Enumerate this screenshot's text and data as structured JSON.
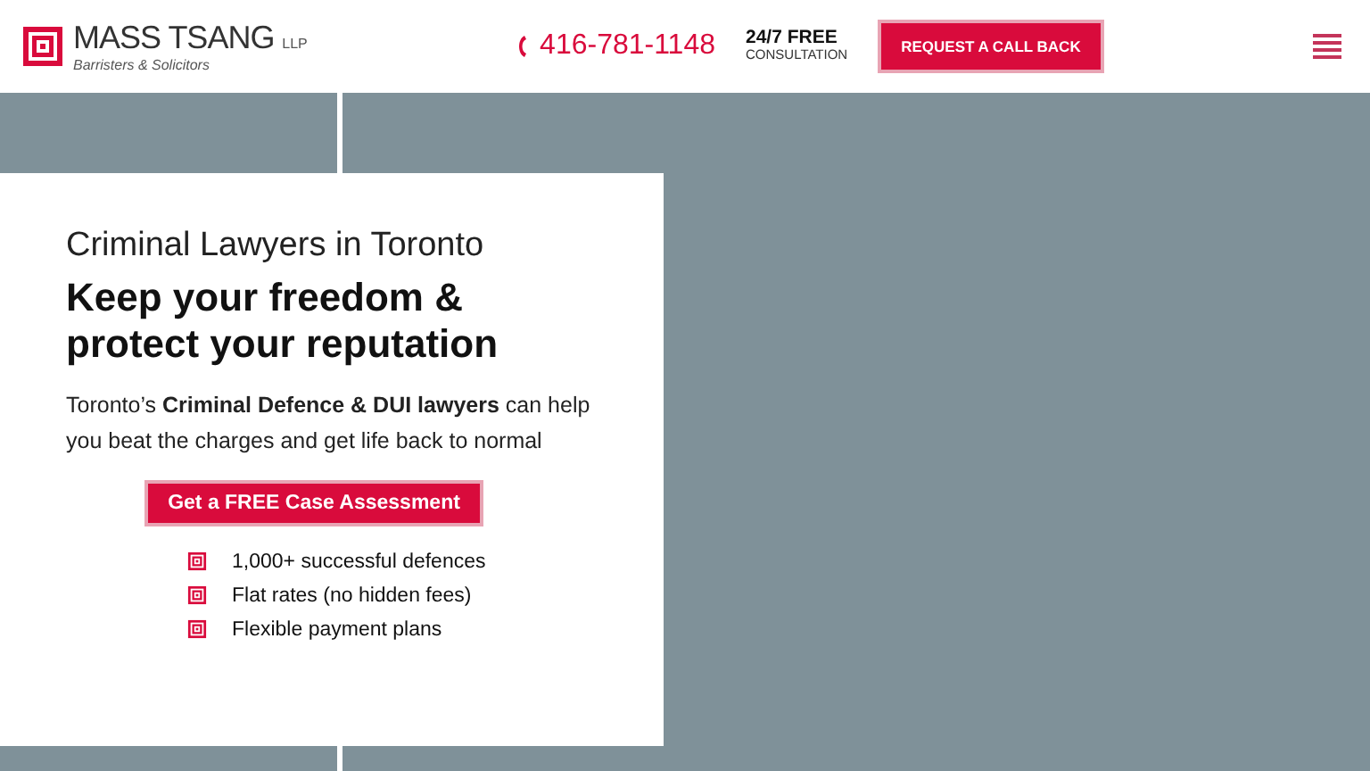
{
  "header": {
    "brand": "MASS TSANG",
    "brand_suffix": "LLP",
    "tagline": "Barristers & Solicitors",
    "phone": "416-781-1148",
    "hours": "24/7 FREE",
    "hours_sub": "CONSULTATION",
    "cta": "REQUEST A CALL BACK"
  },
  "hero": {
    "kicker": "Criminal Lawyers in Toronto",
    "headline": "Keep your freedom & protect your reputation",
    "intro": "Toronto’s **Criminal Defence & DUI lawyers** can help you beat the charges and get life back to normal",
    "button": "Get a FREE Case Assessment",
    "points": [
      "1,000+ successful defences",
      "Flat rates (no hidden fees)",
      "Flexible payment plans"
    ]
  }
}
